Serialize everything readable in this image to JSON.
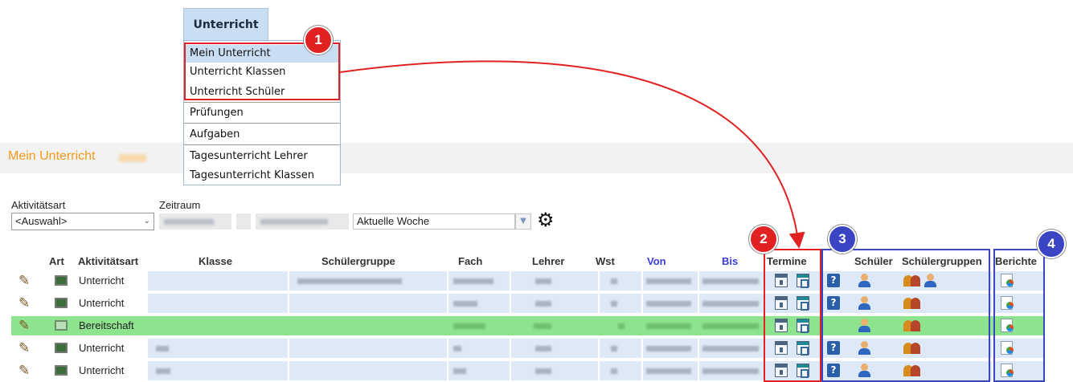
{
  "menu": {
    "tab_label": "Unterricht",
    "items": [
      "Mein Unterricht",
      "Unterricht Klassen",
      "Unterricht Schüler",
      "Prüfungen",
      "Aufgaben",
      "Tagesunterricht Lehrer",
      "Tagesunterricht Klassen"
    ],
    "active_item": "Mein Unterricht"
  },
  "page": {
    "title": "Mein Unterricht"
  },
  "filters": {
    "aktivitaetsart_label": "Aktivitätsart",
    "aktivitaetsart_value": "<Auswahl>",
    "zeitraum_label": "Zeitraum",
    "zeitraum_preset": "Aktuelle Woche"
  },
  "table": {
    "headers": [
      "Art",
      "Aktivitätsart",
      "Klasse",
      "Schülergruppe",
      "Fach",
      "Lehrer",
      "Wst",
      "Von",
      "Bis",
      "Termine",
      "Schüler",
      "Schülergruppen",
      "Berichte"
    ],
    "rows": [
      {
        "aktivitaetsart": "Unterricht",
        "highlight": false
      },
      {
        "aktivitaetsart": "Unterricht",
        "highlight": false
      },
      {
        "aktivitaetsart": "Bereitschaft",
        "highlight": true
      },
      {
        "aktivitaetsart": "Unterricht",
        "highlight": false
      },
      {
        "aktivitaetsart": "Unterricht",
        "highlight": false
      }
    ]
  },
  "annotations": [
    "1",
    "2",
    "3",
    "4"
  ],
  "colors": {
    "title_orange": "#f39a1b",
    "highlight_green": "#8ee38e",
    "annotation_red": "#e02222",
    "annotation_blue": "#3a45c4",
    "header_link_blue": "#3b3bd6"
  }
}
